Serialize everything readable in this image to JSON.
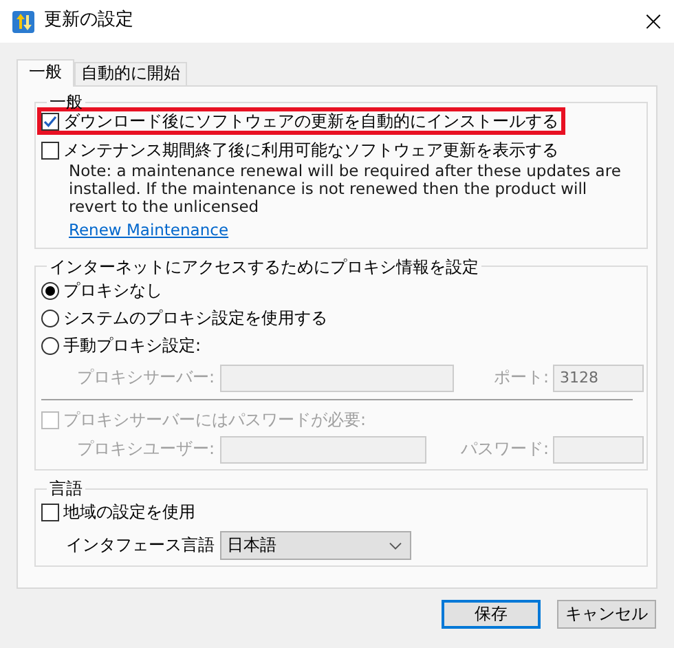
{
  "window": {
    "title": "更新の設定",
    "close": "×"
  },
  "tabs": [
    {
      "label": "一般",
      "selected": true
    },
    {
      "label": "自動的に開始",
      "selected": false
    }
  ],
  "general": {
    "title": "一般",
    "options": [
      {
        "label": "ダウンロード後にソフトウェアの更新を自動的にインストールする",
        "checked": true,
        "highlighted": true
      },
      {
        "label": "メンテナンス期間終了後に利用可能なソフトウェア更新を表示する",
        "checked": false,
        "highlighted": false
      }
    ],
    "note": "Note: a maintenance renewal will be required after these updates are installed. If the maintenance is not renewed then the product will revert to the unlicensed",
    "link": "Renew Maintenance"
  },
  "proxy": {
    "title": "インターネットにアクセスするためにプロキシ情報を設定",
    "options": [
      {
        "label": "プロキシなし",
        "selected": true
      },
      {
        "label": "システムのプロキシ設定を使用する",
        "selected": false
      },
      {
        "label": "手動プロキシ設定:",
        "selected": false
      }
    ],
    "fields_disabled": true,
    "server_label": "プロキシサーバー:",
    "port_label": "ポート:",
    "port_value": "3128",
    "auth": {
      "label": "プロキシサーバーにはパスワードが必要:",
      "checked": false,
      "disabled": true
    },
    "user_label": "プロキシユーザー:",
    "password_label": "パスワード:"
  },
  "language": {
    "title": "言語",
    "use_regional": {
      "label": "地域の設定を使用",
      "checked": false
    },
    "interface_label": "インタフェース言語",
    "interface_value": "日本語"
  },
  "buttons": [
    {
      "label": "保存",
      "default": true
    },
    {
      "label": "キャンセル",
      "default": false
    }
  ]
}
